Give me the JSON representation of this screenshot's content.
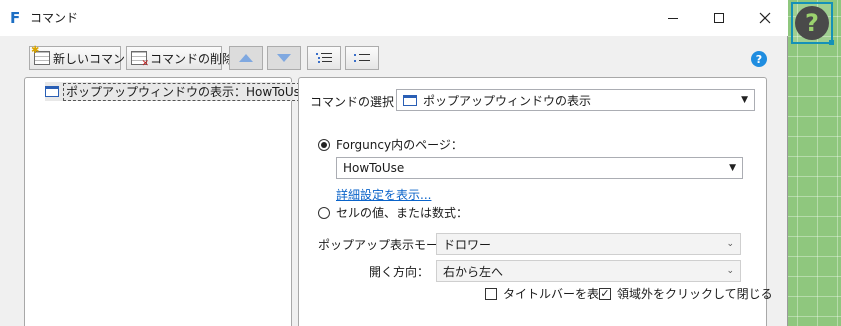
{
  "window": {
    "logo": "F",
    "title": "コマンド"
  },
  "toolbar": {
    "new_command": "新しいコマンド",
    "delete_command": "コマンドの削除"
  },
  "tree": {
    "items": [
      {
        "label": "ポップアップウィンドウの表示：HowToUse",
        "icon": "window-icon"
      }
    ]
  },
  "command_select": {
    "label": "コマンドの選択：",
    "value": "ポップアップウィンドウの表示"
  },
  "page_option": {
    "label": "Forguncy内のページ：",
    "selected": true,
    "value": "HowToUse",
    "detail_link": "詳細設定を表示..."
  },
  "formula_option": {
    "label": "セルの値、または数式：",
    "selected": false
  },
  "popup_mode": {
    "label": "ポップアップ表示モード：",
    "value": "ドロワー"
  },
  "open_direction": {
    "label": "開く方向：",
    "value": "右から左へ"
  },
  "show_titlebar": {
    "label": "タイトルバーを表示",
    "checked": false
  },
  "close_outside": {
    "label": "領域外をクリックして閉じる",
    "checked": true
  },
  "help_widget": {
    "glyph": "?"
  },
  "colors": {
    "accent": "#1f8de0",
    "link": "#0a63c9",
    "canvas": "#8fc77e"
  }
}
